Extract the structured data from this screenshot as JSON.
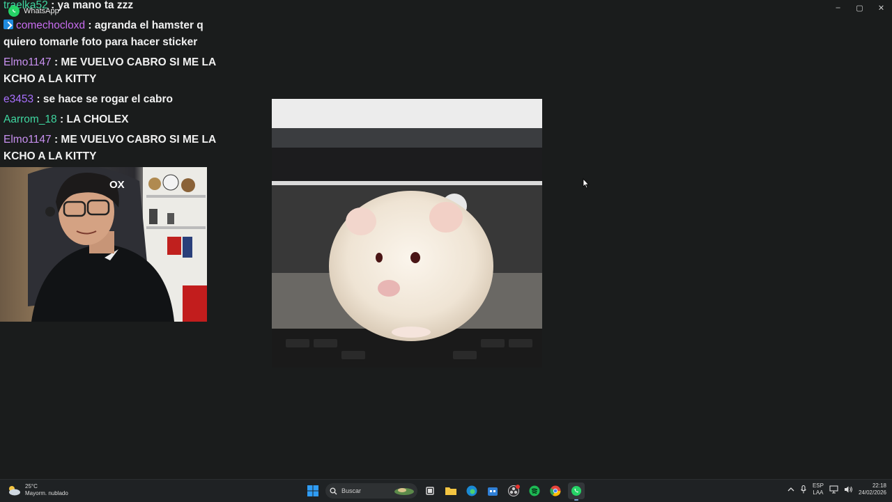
{
  "window": {
    "app_title": "WhatsApp",
    "controls": {
      "minimize": "–",
      "maximize": "▢",
      "close": "✕"
    }
  },
  "chat": {
    "messages": [
      {
        "user": "traelka52",
        "text": " : ya mano ta zzz",
        "color": "#3fd6a0",
        "badge": false
      },
      {
        "user": "comechocloxd",
        "text": " : agranda el hamster q quiero tomarle foto para hacer sticker",
        "color": "#c86cf0",
        "badge": true
      },
      {
        "user": "Elmo1147",
        "text": " : ME VUELVO CABRO SI ME LA KCHO A LA KITTY",
        "color": "#c890f0",
        "badge": false
      },
      {
        "user": "e3453",
        "text": " : se hace se rogar el cabro",
        "color": "#a970ff",
        "badge": false
      },
      {
        "user": "Aarrom_18",
        "text": " : LA CHOLEX",
        "color": "#3fd6a0",
        "badge": false
      },
      {
        "user": "Elmo1147",
        "text": " : ME VUELVO CABRO SI ME LA KCHO A LA KITTY",
        "color": "#c890f0",
        "badge": false
      }
    ]
  },
  "webcam": {
    "overlay_logo": "OX"
  },
  "taskbar": {
    "weather": {
      "temp": "25°C",
      "desc": "Mayorm. nublado"
    },
    "search_placeholder": "Buscar",
    "language": {
      "line1": "ESP",
      "line2": "LAA"
    },
    "clock": {
      "time": "22:18",
      "date": "24/02/2026"
    },
    "colors": {
      "windows_blue": "#2f9cf4",
      "spotify_green": "#1db954",
      "whatsapp_green": "#25d366"
    }
  }
}
